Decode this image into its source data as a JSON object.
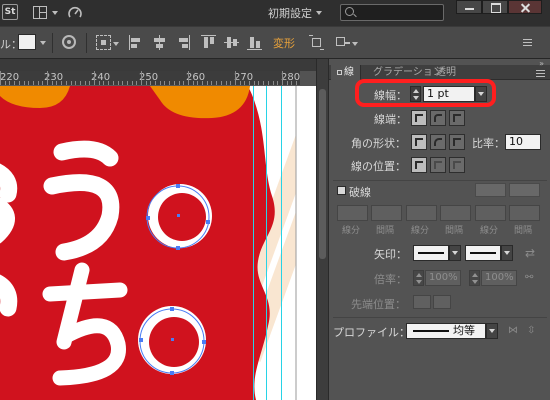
{
  "menubar": {
    "app_logo": "St",
    "workspace": "初期設定"
  },
  "search": {
    "placeholder": ""
  },
  "controlbar": {
    "stroke_label": "ル：",
    "transform_link": "変形"
  },
  "ruler": {
    "ticks": [
      "220",
      "230",
      "240",
      "250",
      "260",
      "270",
      "280"
    ]
  },
  "artwork": {
    "bg_color": "#d0121e",
    "accent_color": "#f08a00",
    "text_line1": "うO",
    "text_line2": "ちO"
  },
  "panel": {
    "tabs": [
      "線",
      "グラデーション",
      "透明"
    ],
    "weight_label": "線幅：",
    "weight_value": "1 pt",
    "cap_label": "線端：",
    "corner_label": "角の形状：",
    "limit_label": "比率：",
    "limit_value": "10",
    "align_label": "線の位置：",
    "dashed_label": "破線",
    "dash_headers": [
      "線分",
      "間隔",
      "線分",
      "間隔",
      "線分",
      "間隔"
    ],
    "arrow_label": "矢印：",
    "scale_label": "倍率：",
    "scale_start": "100%",
    "scale_end": "100%",
    "tip_label": "先端位置：",
    "profile_label": "プロファイル：",
    "profile_value": "均等",
    "highlight_color": "#ff1f1f"
  }
}
